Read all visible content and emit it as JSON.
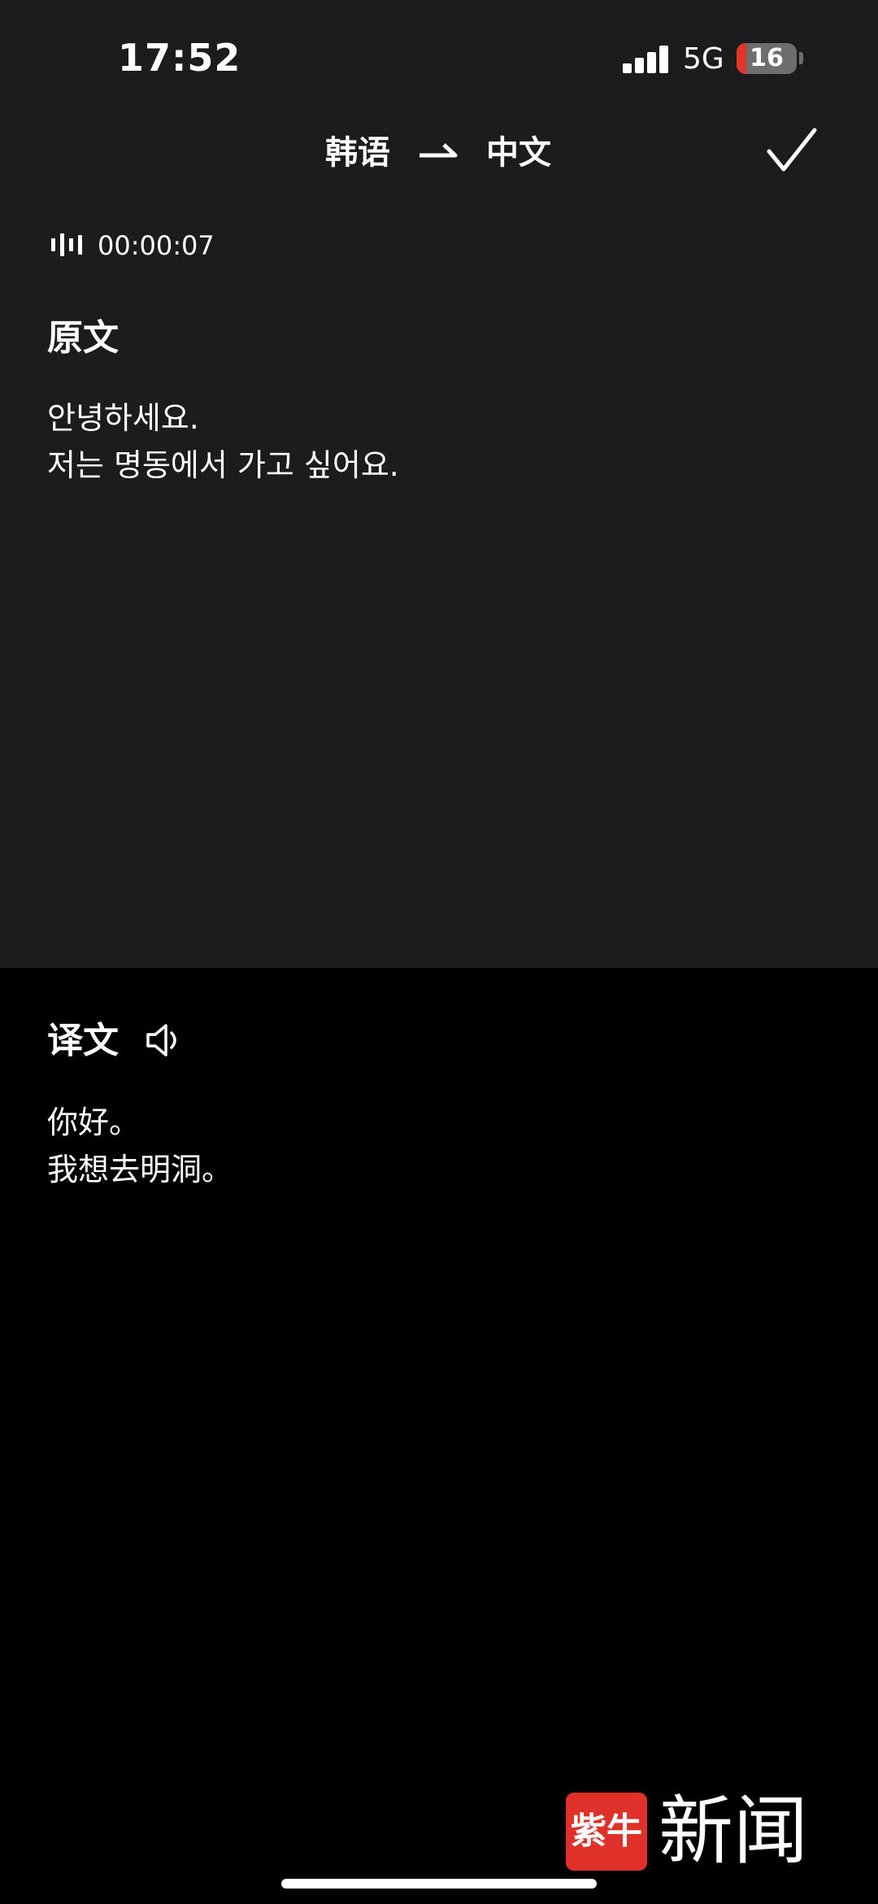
{
  "status_bar": {
    "time": "17:52",
    "network": "5G",
    "battery_level": "16",
    "battery_fraction": 0.16,
    "signal_bars": 4
  },
  "header": {
    "source_language": "韩语",
    "target_language": "中文",
    "confirm_icon": "checkmark-icon",
    "swap_icon": "arrow-right-icon"
  },
  "recording": {
    "icon": "waveform-icon",
    "elapsed": "00:00:07"
  },
  "original": {
    "title": "原文",
    "lines": [
      "안녕하세요.",
      "저는 명동에서 가고 싶어요."
    ]
  },
  "translation": {
    "title": "译文",
    "speaker_icon": "speaker-icon",
    "lines": [
      "你好。",
      "我想去明洞。"
    ]
  },
  "watermark": {
    "logo_mark": "紫牛",
    "logo_word": "新闻"
  },
  "colors": {
    "top_panel_bg": "#1c1c1e",
    "bottom_panel_bg": "#000000",
    "text": "#ffffff",
    "battery_low": "#e0352b",
    "logo_red": "#e0302a"
  }
}
